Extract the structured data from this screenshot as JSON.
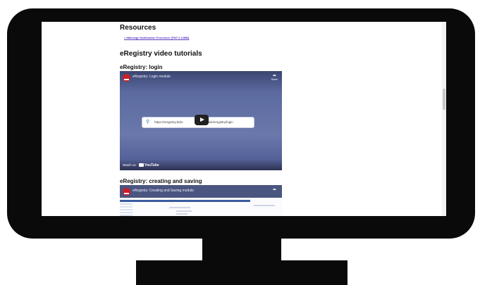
{
  "page": {
    "resources_heading": "Resources",
    "resource_links": [
      "eMarriage Notification Procedure (PDF 2.14MB)"
    ],
    "tutorials_heading": "eRegistry video tutorials"
  },
  "videos": [
    {
      "heading": "eRegistry: login",
      "title": "eRegistry: Login module",
      "url_text": "https://eregistry.bdm.",
      "url_text_tail": "au/lifelink/eregistry/login",
      "share_label": "Share",
      "watch_label": "Watch on",
      "brand": "YouTube"
    },
    {
      "heading": "eRegistry: creating and saving",
      "title": "eRegistry: Creating and Saving module"
    }
  ],
  "colors": {
    "link": "#5b3cc4",
    "monitor": "#0a0a0a",
    "video_bg": "#5b6aa0"
  },
  "icons": {
    "share": "share-arrow-icon",
    "search": "search-icon",
    "play": "play-icon",
    "logo": "channel-logo-icon"
  }
}
